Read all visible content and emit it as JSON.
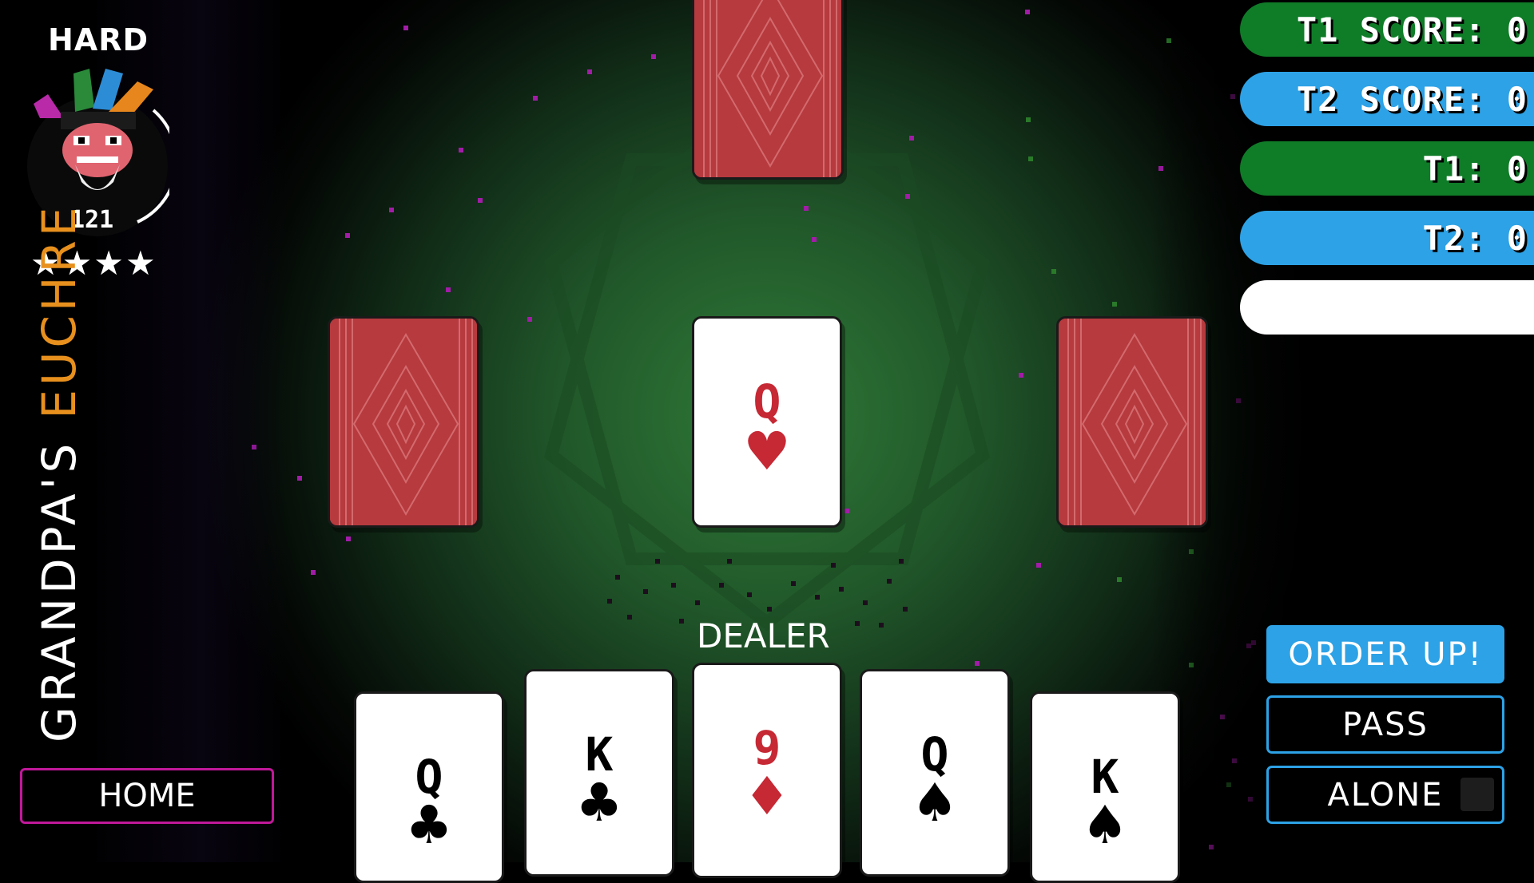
{
  "difficulty": "HARD",
  "avatar": {
    "name": "jester-avatar",
    "count": "121",
    "progress": 0.33
  },
  "stars": "★★★★",
  "title": {
    "word1": "GRANDPA'S",
    "word2": "EUCHRE"
  },
  "home_button": "HOME",
  "scoreboard": {
    "t1_score": "T1 SCORE: 0",
    "t2_score": "T2 SCORE: 0",
    "t1_tricks": "T1: 0",
    "t2_tricks": "T2: 0",
    "status": ""
  },
  "upcard": {
    "rank": "Q",
    "suit": "♥",
    "color": "#c62834"
  },
  "dealer_label": "DEALER",
  "hand": [
    {
      "rank": "Q",
      "suit": "♣"
    },
    {
      "rank": "K",
      "suit": "♣"
    },
    {
      "rank": "9",
      "suit": "♦"
    },
    {
      "rank": "Q",
      "suit": "♠"
    },
    {
      "rank": "K",
      "suit": "♠"
    }
  ],
  "actions": {
    "order_up": "ORDER UP!",
    "pass": "PASS",
    "alone": "ALONE"
  },
  "colors": {
    "team1": "#0f7c28",
    "team2": "#2da2e6",
    "accent": "#c0189a",
    "card_back": "#b63a3e",
    "title_accent": "#e8901e"
  }
}
